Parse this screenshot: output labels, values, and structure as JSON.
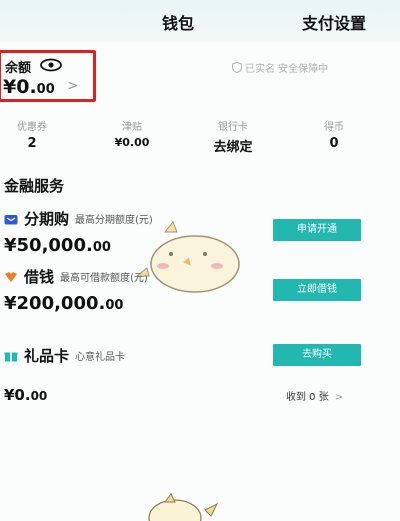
{
  "header": {
    "title": "钱包",
    "settings": "支付设置"
  },
  "balance": {
    "label": "余额",
    "amount_int": "¥0.",
    "amount_dec": "00",
    "chevron": ">"
  },
  "security_note": "已实名 安全保障中",
  "stats": [
    {
      "key": "优惠券",
      "value": "2"
    },
    {
      "key": "津贴",
      "value": "¥0.00"
    },
    {
      "key": "银行卡",
      "value": "去绑定"
    },
    {
      "key": "得币",
      "value": "0"
    }
  ],
  "finance": {
    "title": "金融服务",
    "installment": {
      "name": "分期购",
      "sub": "最高分期额度(元)",
      "amount_int": "¥50,000.",
      "amount_dec": "00",
      "button": "申请开通"
    },
    "loan": {
      "name": "借钱",
      "sub": "最高可借款额度(元)",
      "amount_int": "¥200,000.",
      "amount_dec": "00",
      "button": "立即借钱"
    },
    "giftcard": {
      "name": "礼品卡",
      "sub": "心意礼品卡",
      "button": "去购买",
      "amount_int": "¥0.",
      "amount_dec": "00",
      "received": "收到 0 张",
      "chevron": ">"
    }
  },
  "colors": {
    "accent": "#22b8b0",
    "highlight_border": "#e02020",
    "installment_icon": "#2a5bd7",
    "loan_icon": "#f07c1c",
    "gift_icon": "#22b8b0"
  },
  "icons": {
    "eye": "eye-icon",
    "shield": "shield-icon",
    "installment": "bag-icon",
    "loan": "heart-handshake-icon",
    "gift": "gift-icon"
  }
}
